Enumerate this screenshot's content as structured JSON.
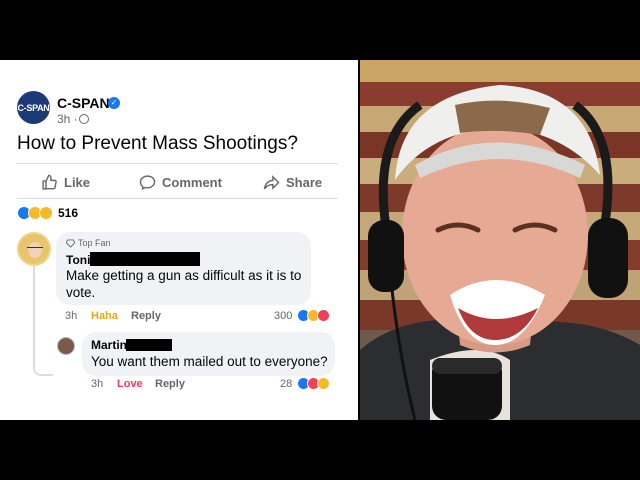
{
  "post": {
    "page_name": "C-SPAN",
    "avatar_text": "C-SPAN",
    "time": "3h ·",
    "title": "How to Prevent Mass Shootings?",
    "actions": {
      "like": "Like",
      "comment": "Comment",
      "share": "Share"
    },
    "reaction_count": "516"
  },
  "comments": [
    {
      "badge": "Top Fan",
      "author": "Toni",
      "text": "Make getting a gun as difficult as it is to vote.",
      "time": "3h",
      "reaction_label": "Haha",
      "reply_label": "Reply",
      "reaction_count": "300"
    },
    {
      "author": "Martin",
      "text": "You want them mailed out to everyone?",
      "time": "3h",
      "reaction_label": "Love",
      "reply_label": "Reply",
      "reaction_count": "28"
    }
  ],
  "colors": {
    "facebook_blue": "#1877f2",
    "cspan_navy": "#1d3a78",
    "haha_yellow": "#e4a819",
    "love_red": "#f33e58"
  }
}
